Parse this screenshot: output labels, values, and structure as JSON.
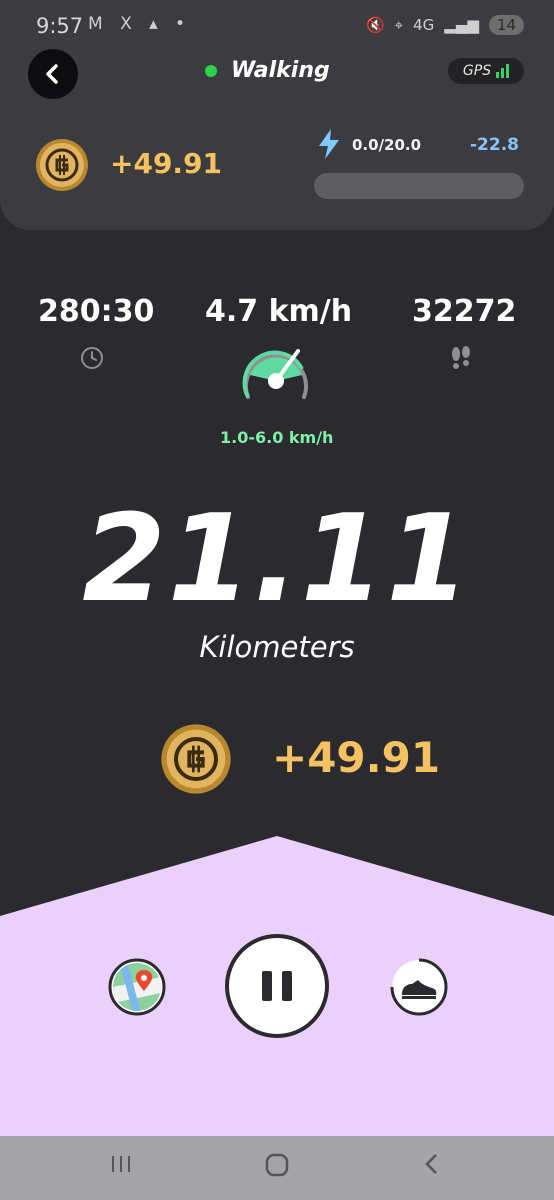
{
  "status_bar": {
    "time": "9:57",
    "left_icons": "M X ▴ •",
    "network": "4G",
    "battery": "14"
  },
  "header": {
    "title": "Walking",
    "gps_label": "GPS",
    "earned": "+49.91",
    "energy": "0.0/20.0",
    "energy_delta": "-22.8",
    "energy_fill_fraction": 0.0
  },
  "stats": {
    "time": "280:30",
    "speed": "4.7 km/h",
    "steps": "32272",
    "speed_range": "1.0-6.0 km/h"
  },
  "main": {
    "distance": "21.11",
    "unit": "Kilometers",
    "earned": "+49.91"
  },
  "controls": {
    "map": "map-pin-icon",
    "pause": "pause-icon",
    "shoe": "sneaker-icon"
  },
  "colors": {
    "accent_gold": "#f6c160",
    "green": "#7ff0a8",
    "panel": "#ead0fb"
  }
}
